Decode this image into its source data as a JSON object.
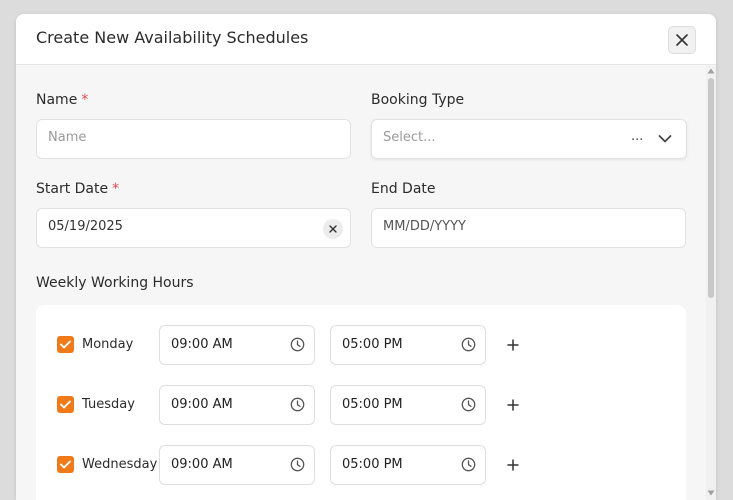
{
  "modal": {
    "title": "Create New Availability Schedules"
  },
  "form": {
    "name_label": "Name",
    "name_placeholder": "Name",
    "booking_type_label": "Booking Type",
    "booking_type_placeholder": "Select...",
    "booking_type_ellipsis": "...",
    "start_date_label": "Start Date",
    "start_date_value": "05/19/2025",
    "end_date_label": "End Date",
    "end_date_placeholder": "MM/DD/YYYY",
    "required_marker": "*"
  },
  "weekly": {
    "title": "Weekly Working Hours",
    "days": [
      {
        "name": "Monday",
        "checked": true,
        "start": "09:00 AM",
        "end": "05:00 PM"
      },
      {
        "name": "Tuesday",
        "checked": true,
        "start": "09:00 AM",
        "end": "05:00 PM"
      },
      {
        "name": "Wednesday",
        "checked": true,
        "start": "09:00 AM",
        "end": "05:00 PM"
      }
    ]
  },
  "icons": {
    "close": "close-icon",
    "chevron": "chevron-down-icon",
    "clear": "clear-icon",
    "clock": "clock-icon",
    "check": "check-icon",
    "add": "plus-icon"
  },
  "colors": {
    "accent": "#f07a1a",
    "required": "#e5484d"
  }
}
